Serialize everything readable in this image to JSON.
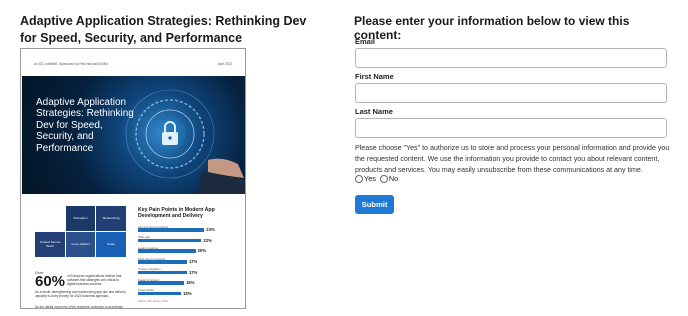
{
  "content": {
    "title": "Adaptive Application Strategies: Rethinking Dev for Speed, Security, and Performance",
    "thumbnail": {
      "header_left": "An IDC InfoBrief, Sponsored by Red Hat and NGINX",
      "header_right": "April 2022",
      "hero_title": "Adaptive Application Strategies: Rethinking Dev for Speed, Security, and Performance",
      "grid_cells": [
        "Disruption",
        "Modernizing",
        "Trusted Secure Build",
        "Go-to-Market",
        "Scale"
      ],
      "stat_intro": "Over",
      "stat_value": "60%",
      "stat_text": "of European organizations believe that software-first strategies are critical to digital business success.",
      "stat_text2": "As a result, strengthening and modernizing app dev and delivery capacity is a key priority for 2022 business agendas.",
      "bottom_text": "As the digital economy of the business continues to accelerate",
      "key_points": {
        "title": "Key Pain Points in Modern App Development and Delivery",
        "rows": [
          {
            "label": "Security and compliance",
            "value": "23%",
            "pct": 23
          },
          {
            "label": "Skills gap",
            "value": "22%",
            "pct": 22
          },
          {
            "label": "Legacy systems",
            "value": "20%",
            "pct": 20
          },
          {
            "label": "Multi-cloud complexity",
            "value": "17%",
            "pct": 17
          },
          {
            "label": "Tooling integration",
            "value": "17%",
            "pct": 17
          },
          {
            "label": "Speed of delivery",
            "value": "16%",
            "pct": 16
          },
          {
            "label": "Observability",
            "value": "15%",
            "pct": 15
          }
        ],
        "footnote": "Source: IDC Survey, 2022"
      }
    }
  },
  "form": {
    "heading": "Please enter your information below to view this content:",
    "email_label": "Email",
    "email_value": "",
    "first_name_label": "First Name",
    "first_name_value": "",
    "last_name_label": "Last Name",
    "last_name_value": "",
    "consent_text": "Please choose \"Yes\" to authorize us to store and process your personal information and provide you the requested content. We use the information you provide to contact you about relevant content, products and services. You may easily unsubscribe from these communications at any time.",
    "yes_label": "Yes",
    "no_label": "No",
    "submit_label": "Submit"
  },
  "colors": {
    "accent": "#1f7ad6",
    "hero_dark": "#06213f",
    "bar": "#1e6db8"
  }
}
